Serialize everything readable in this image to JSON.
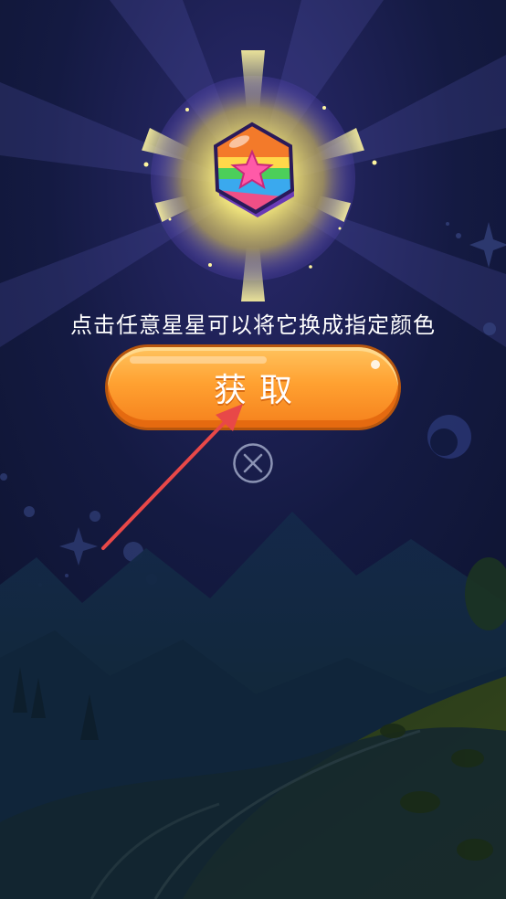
{
  "dialog": {
    "message": "点击任意星星可以将它换成指定颜色",
    "get_button_label": "获取"
  },
  "icons": {
    "reward": "rainbow-hexagon-candy-icon",
    "close": "close-circle-icon",
    "pointer": "red-arrow-annotation"
  },
  "colors": {
    "background": "#0e1530",
    "button_orange": "#ffa131",
    "glow": "#fff26a",
    "arrow": "#e84848",
    "hill_green": "#20341f"
  }
}
